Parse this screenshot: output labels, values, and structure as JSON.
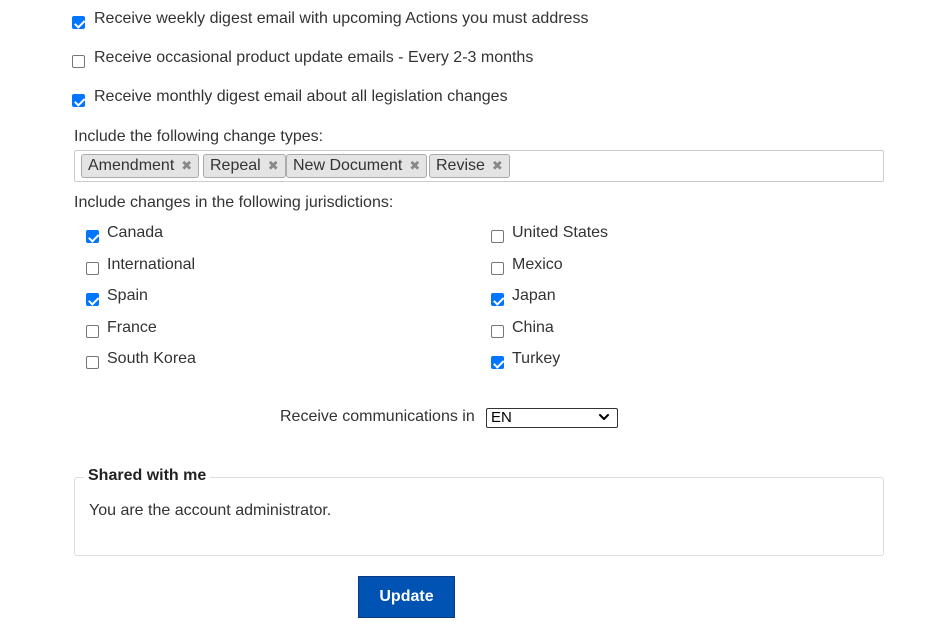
{
  "email_options": [
    {
      "label": "Receive weekly digest email with upcoming Actions you must address",
      "checked": true
    },
    {
      "label": "Receive occasional product update emails - Every 2-3 months",
      "checked": false
    },
    {
      "label": "Receive monthly digest email about all legislation changes",
      "checked": true
    }
  ],
  "change_types": {
    "label": "Include the following change types:",
    "tags": [
      "Amendment",
      "Repeal",
      "New Document",
      "Revise"
    ],
    "remove_glyph": "✖"
  },
  "jurisdictions": {
    "label": "Include changes in the following jurisdictions:",
    "left": [
      {
        "name": "Canada",
        "checked": true
      },
      {
        "name": "International",
        "checked": false
      },
      {
        "name": "Spain",
        "checked": true
      },
      {
        "name": "France",
        "checked": false
      },
      {
        "name": "South Korea",
        "checked": false
      }
    ],
    "right": [
      {
        "name": "United States",
        "checked": false
      },
      {
        "name": "Mexico",
        "checked": false
      },
      {
        "name": "Japan",
        "checked": true
      },
      {
        "name": "China",
        "checked": false
      },
      {
        "name": "Turkey",
        "checked": true
      }
    ]
  },
  "language": {
    "label": "Receive communications in",
    "selected": "EN"
  },
  "shared": {
    "legend": "Shared with me",
    "message": "You are the account administrator."
  },
  "update_button": "Update",
  "colors": {
    "checkbox_checked": "#0075ff",
    "button_bg": "#0053b3"
  }
}
